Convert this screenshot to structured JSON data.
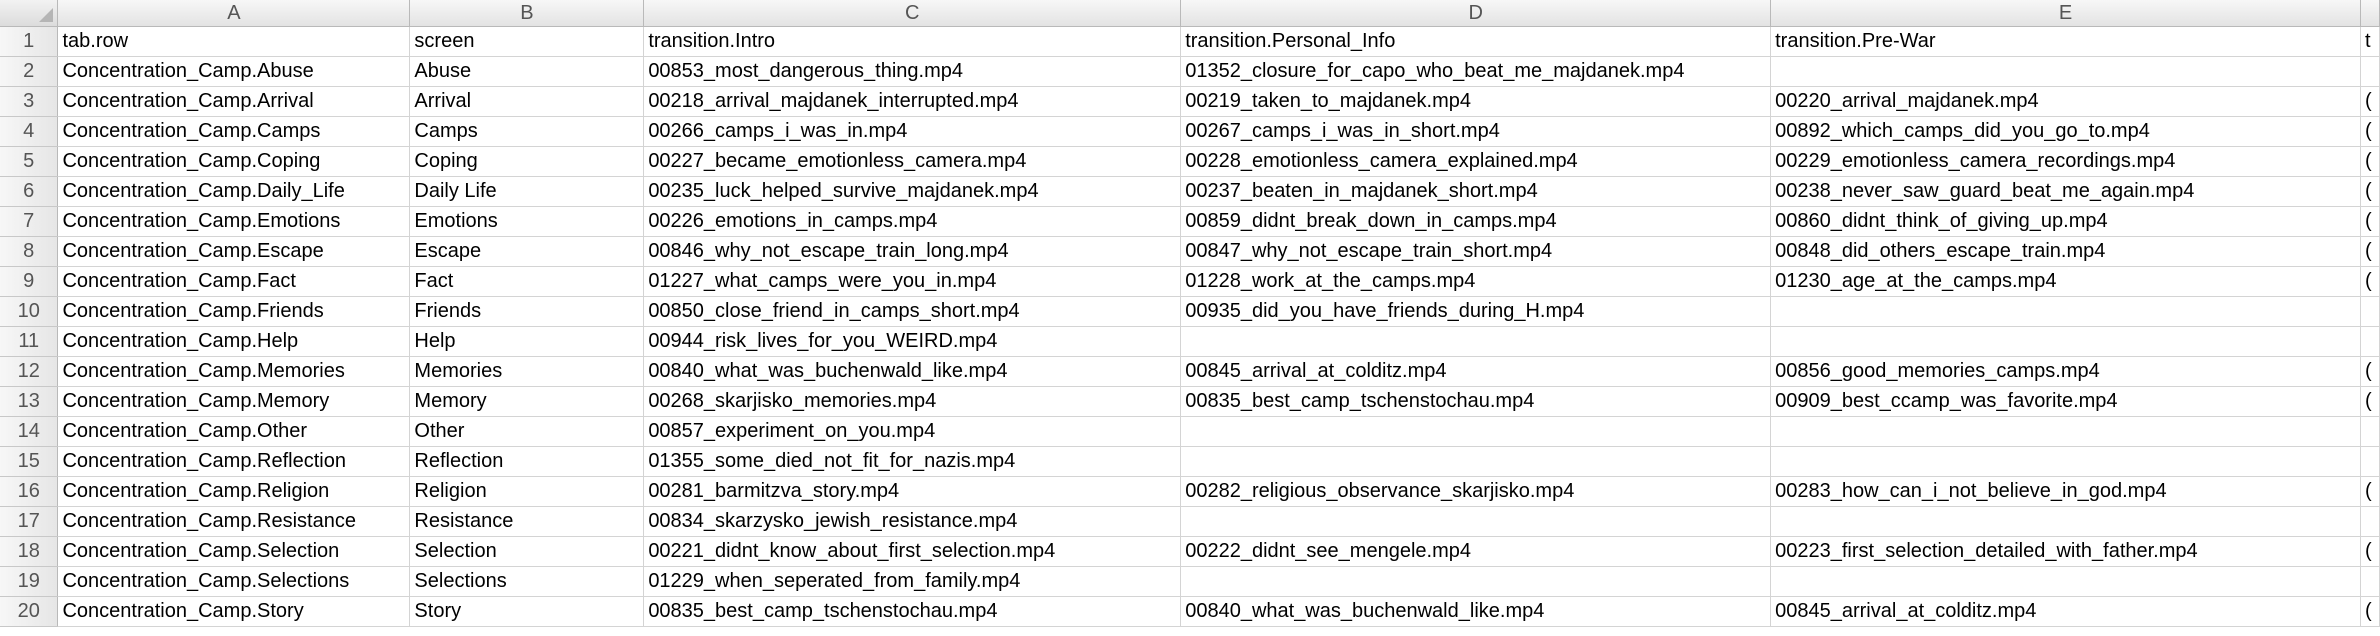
{
  "columns": [
    "A",
    "B",
    "C",
    "D",
    "E"
  ],
  "rows": [
    {
      "num": "1",
      "a": "tab.row",
      "b": "screen",
      "c": "transition.Intro",
      "d": "transition.Personal_Info",
      "e": "transition.Pre-War",
      "f": "t"
    },
    {
      "num": "2",
      "a": "Concentration_Camp.Abuse",
      "b": "Abuse",
      "c": "00853_most_dangerous_thing.mp4",
      "d": "01352_closure_for_capo_who_beat_me_majdanek.mp4",
      "e": "",
      "f": ""
    },
    {
      "num": "3",
      "a": "Concentration_Camp.Arrival",
      "b": "Arrival",
      "c": "00218_arrival_majdanek_interrupted.mp4",
      "d": "00219_taken_to_majdanek.mp4",
      "e": "00220_arrival_majdanek.mp4",
      "f": "("
    },
    {
      "num": "4",
      "a": "Concentration_Camp.Camps",
      "b": "Camps",
      "c": "00266_camps_i_was_in.mp4",
      "d": "00267_camps_i_was_in_short.mp4",
      "e": "00892_which_camps_did_you_go_to.mp4",
      "f": "("
    },
    {
      "num": "5",
      "a": "Concentration_Camp.Coping",
      "b": "Coping",
      "c": "00227_became_emotionless_camera.mp4",
      "d": "00228_emotionless_camera_explained.mp4",
      "e": "00229_emotionless_camera_recordings.mp4",
      "f": "("
    },
    {
      "num": "6",
      "a": "Concentration_Camp.Daily_Life",
      "b": "Daily Life",
      "c": "00235_luck_helped_survive_majdanek.mp4",
      "d": "00237_beaten_in_majdanek_short.mp4",
      "e": "00238_never_saw_guard_beat_me_again.mp4",
      "f": "("
    },
    {
      "num": "7",
      "a": "Concentration_Camp.Emotions",
      "b": "Emotions",
      "c": "00226_emotions_in_camps.mp4",
      "d": "00859_didnt_break_down_in_camps.mp4",
      "e": "00860_didnt_think_of_giving_up.mp4",
      "f": "("
    },
    {
      "num": "8",
      "a": "Concentration_Camp.Escape",
      "b": "Escape",
      "c": "00846_why_not_escape_train_long.mp4",
      "d": "00847_why_not_escape_train_short.mp4",
      "e": "00848_did_others_escape_train.mp4",
      "f": "("
    },
    {
      "num": "9",
      "a": "Concentration_Camp.Fact",
      "b": "Fact",
      "c": "01227_what_camps_were_you_in.mp4",
      "d": "01228_work_at_the_camps.mp4",
      "e": "01230_age_at_the_camps.mp4",
      "f": "("
    },
    {
      "num": "10",
      "a": "Concentration_Camp.Friends",
      "b": "Friends",
      "c": "00850_close_friend_in_camps_short.mp4",
      "d": "00935_did_you_have_friends_during_H.mp4",
      "e": "",
      "f": ""
    },
    {
      "num": "11",
      "a": "Concentration_Camp.Help",
      "b": "Help",
      "c": "00944_risk_lives_for_you_WEIRD.mp4",
      "d": "",
      "e": "",
      "f": ""
    },
    {
      "num": "12",
      "a": "Concentration_Camp.Memories",
      "b": "Memories",
      "c": "00840_what_was_buchenwald_like.mp4",
      "d": "00845_arrival_at_colditz.mp4",
      "e": "00856_good_memories_camps.mp4",
      "f": "("
    },
    {
      "num": "13",
      "a": "Concentration_Camp.Memory",
      "b": "Memory",
      "c": "00268_skarjisko_memories.mp4",
      "d": "00835_best_camp_tschenstochau.mp4",
      "e": "00909_best_ccamp_was_favorite.mp4",
      "f": "("
    },
    {
      "num": "14",
      "a": "Concentration_Camp.Other",
      "b": "Other",
      "c": "00857_experiment_on_you.mp4",
      "d": "",
      "e": "",
      "f": ""
    },
    {
      "num": "15",
      "a": "Concentration_Camp.Reflection",
      "b": "Reflection",
      "c": "01355_some_died_not_fit_for_nazis.mp4",
      "d": "",
      "e": "",
      "f": ""
    },
    {
      "num": "16",
      "a": "Concentration_Camp.Religion",
      "b": "Religion",
      "c": "00281_barmitzva_story.mp4",
      "d": "00282_religious_observance_skarjisko.mp4",
      "e": "00283_how_can_i_not_believe_in_god.mp4",
      "f": "("
    },
    {
      "num": "17",
      "a": "Concentration_Camp.Resistance",
      "b": "Resistance",
      "c": "00834_skarzysko_jewish_resistance.mp4",
      "d": "",
      "e": "",
      "f": ""
    },
    {
      "num": "18",
      "a": "Concentration_Camp.Selection",
      "b": "Selection",
      "c": "00221_didnt_know_about_first_selection.mp4",
      "d": "00222_didnt_see_mengele.mp4",
      "e": "00223_first_selection_detailed_with_father.mp4",
      "f": "("
    },
    {
      "num": "19",
      "a": "Concentration_Camp.Selections",
      "b": "Selections",
      "c": "01229_when_seperated_from_family.mp4",
      "d": "",
      "e": "",
      "f": ""
    },
    {
      "num": "20",
      "a": "Concentration_Camp.Story",
      "b": "Story",
      "c": "00835_best_camp_tschenstochau.mp4",
      "d": "00840_what_was_buchenwald_like.mp4",
      "e": "00845_arrival_at_colditz.mp4",
      "f": "("
    }
  ]
}
